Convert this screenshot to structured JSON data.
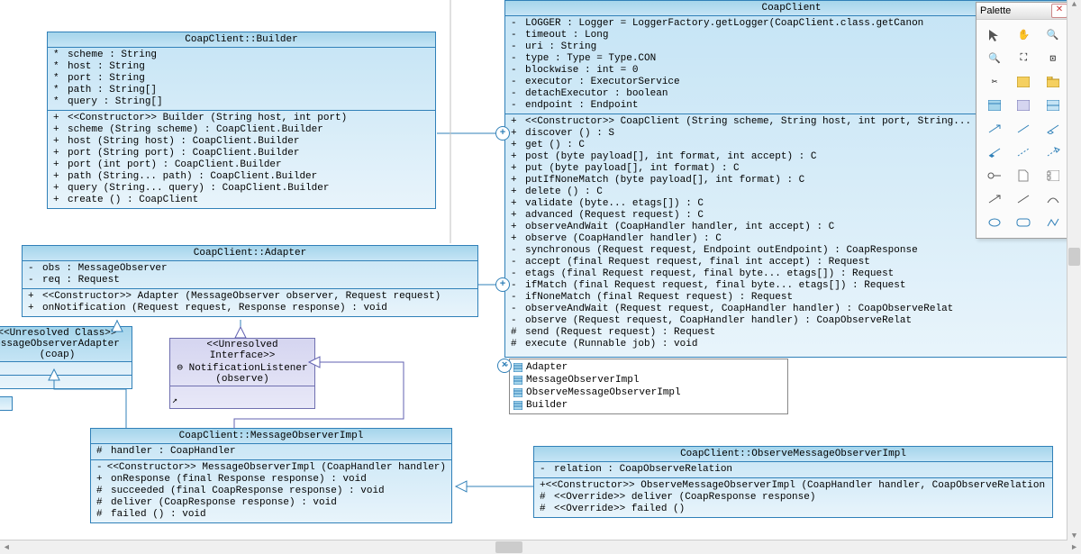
{
  "palette_title": "Palette",
  "builder": {
    "title": "CoapClient::Builder",
    "attrs": [
      {
        "v": "*",
        "t": "scheme  : String"
      },
      {
        "v": "*",
        "t": "host    : String"
      },
      {
        "v": "*",
        "t": "port    : String"
      },
      {
        "v": "*",
        "t": "path    : String[]"
      },
      {
        "v": "*",
        "t": "query   : String[]"
      }
    ],
    "ops": [
      {
        "v": "+",
        "t": "<<Constructor>>  Builder (String host, int port)"
      },
      {
        "v": "+",
        "t": "                 scheme (String scheme)          : CoapClient.Builder"
      },
      {
        "v": "+",
        "t": "                 host (String host)              : CoapClient.Builder"
      },
      {
        "v": "+",
        "t": "                 port (String port)              : CoapClient.Builder"
      },
      {
        "v": "+",
        "t": "                 port (int port)                 : CoapClient.Builder"
      },
      {
        "v": "+",
        "t": "                 path (String... path)           : CoapClient.Builder"
      },
      {
        "v": "+",
        "t": "                 query (String... query)         : CoapClient.Builder"
      },
      {
        "v": "+",
        "t": "                 create ()                       : CoapClient"
      }
    ]
  },
  "adapter": {
    "title": "CoapClient::Adapter",
    "attrs": [
      {
        "v": "-",
        "t": "obs  : MessageObserver"
      },
      {
        "v": "-",
        "t": "req  : Request"
      }
    ],
    "ops": [
      {
        "v": "+",
        "t": "<<Constructor>>  Adapter (MessageObserver observer, Request request)"
      },
      {
        "v": "+",
        "t": "                 onNotification (Request request, Response response)  : void"
      }
    ]
  },
  "unresolved_class": {
    "stereo": "<<Unresolved Class>>",
    "name": "essageObserverAdapter",
    "pkg": "(coap)"
  },
  "unresolved_iface": {
    "stereo": "<<Unresolved Interface>>",
    "name": "NotificationListener",
    "pkg": "(observe)"
  },
  "msgobs": {
    "title": "CoapClient::MessageObserverImpl",
    "attrs": [
      {
        "v": "#",
        "t": "handler  : CoapHandler"
      }
    ],
    "ops": [
      {
        "v": "-",
        "t": "<<Constructor>>  MessageObserverImpl (CoapHandler handler)"
      },
      {
        "v": "+",
        "t": "                 onResponse (final Response response)        : void"
      },
      {
        "v": "#",
        "t": "                 succeeded (final CoapResponse response)     : void"
      },
      {
        "v": "#",
        "t": "                 deliver (CoapResponse response)             : void"
      },
      {
        "v": "#",
        "t": "                 failed ()                                   : void"
      }
    ]
  },
  "obsmsg": {
    "title": "CoapClient::ObserveMessageObserverImpl",
    "attrs": [
      {
        "v": "-",
        "t": "relation  : CoapObserveRelation"
      }
    ],
    "ops": [
      {
        "v": "+",
        "t": "<<Constructor>>  ObserveMessageObserverImpl (CoapHandler handler, CoapObserveRelation relation)"
      },
      {
        "v": "#",
        "t": "<<Override>>     deliver (CoapResponse response)"
      },
      {
        "v": "#",
        "t": "<<Override>>     failed ()"
      }
    ]
  },
  "coapclient": {
    "title": "CoapClient",
    "attrs": [
      {
        "v": "-",
        "t": "LOGGER          : Logger           = LoggerFactory.getLogger(CoapClient.class.getCanon"
      },
      {
        "v": "-",
        "t": "timeout         : Long"
      },
      {
        "v": "-",
        "t": "uri             : String"
      },
      {
        "v": "-",
        "t": "type            : Type             = Type.CON"
      },
      {
        "v": "-",
        "t": "blockwise       : int              = 0"
      },
      {
        "v": "-",
        "t": "executor        : ExecutorService"
      },
      {
        "v": "-",
        "t": "detachExecutor  : boolean"
      },
      {
        "v": "-",
        "t": "endpoint        : Endpoint"
      }
    ],
    "ops": [
      {
        "v": "+",
        "t": "<<Constructor>>  CoapClient (String scheme, String host, int port, String... path)"
      },
      {
        "v": "+",
        "t": "                 discover ()                                                          : S"
      },
      {
        "v": "+",
        "t": "                 get ()                                                               : C"
      },
      {
        "v": "+",
        "t": "                 post (byte payload[], int format, int accept)                        : C"
      },
      {
        "v": "+",
        "t": "                 put (byte payload[], int format)                                     : C"
      },
      {
        "v": "+",
        "t": "                 putIfNoneMatch (byte payload[], int format)                          : C"
      },
      {
        "v": "+",
        "t": "                 delete ()                                                            : C"
      },
      {
        "v": "+",
        "t": "                 validate (byte... etags[])                                           : C"
      },
      {
        "v": "+",
        "t": "                 advanced (Request request)                                           : C"
      },
      {
        "v": "+",
        "t": "                 observeAndWait (CoapHandler handler, int accept)                     : C"
      },
      {
        "v": "+",
        "t": "                 observe (CoapHandler handler)                                        : C"
      },
      {
        "v": "-",
        "t": "                 synchronous (Request request, Endpoint outEndpoint)                  : CoapResponse"
      },
      {
        "v": "-",
        "t": "                 accept (final Request request, final int accept)                     : Request"
      },
      {
        "v": "-",
        "t": "                 etags (final Request request, final byte... etags[])                 : Request"
      },
      {
        "v": "-",
        "t": "                 ifMatch (final Request request, final byte... etags[])               : Request"
      },
      {
        "v": "-",
        "t": "                 ifNoneMatch (final Request request)                                  : Request"
      },
      {
        "v": "-",
        "t": "                 observeAndWait (Request request, CoapHandler handler)                : CoapObserveRelat"
      },
      {
        "v": "-",
        "t": "                 observe (Request request, CoapHandler handler)                       : CoapObserveRelat"
      },
      {
        "v": "#",
        "t": "                 send (Request request)                                               : Request"
      },
      {
        "v": "#",
        "t": "                 execute (Runnable job)                                               : void"
      }
    ]
  },
  "nested": {
    "items": [
      "Adapter",
      "MessageObserverImpl",
      "ObserveMessageObserverImpl",
      "Builder"
    ]
  },
  "chart_data": {
    "type": "uml-class-diagram",
    "classes": [
      {
        "name": "CoapClient::Builder",
        "kind": "class",
        "attributes": [
          "* scheme:String",
          "* host:String",
          "* port:String",
          "* path:String[]",
          "* query:String[]"
        ],
        "operations": [
          "+ <<Constructor>> Builder(String host,int port)",
          "+ scheme(String scheme):CoapClient.Builder",
          "+ host(String host):CoapClient.Builder",
          "+ port(String port):CoapClient.Builder",
          "+ port(int port):CoapClient.Builder",
          "+ path(String... path):CoapClient.Builder",
          "+ query(String... query):CoapClient.Builder",
          "+ create():CoapClient"
        ]
      },
      {
        "name": "CoapClient::Adapter",
        "kind": "class",
        "attributes": [
          "- obs:MessageObserver",
          "- req:Request"
        ],
        "operations": [
          "+ <<Constructor>> Adapter(MessageObserver observer,Request request)",
          "+ onNotification(Request request,Response response):void"
        ]
      },
      {
        "name": "CoapClient::MessageObserverImpl",
        "kind": "class",
        "attributes": [
          "# handler:CoapHandler"
        ],
        "operations": [
          "- <<Constructor>> MessageObserverImpl(CoapHandler handler)",
          "+ onResponse(final Response response):void",
          "# succeeded(final CoapResponse response):void",
          "# deliver(CoapResponse response):void",
          "# failed():void"
        ]
      },
      {
        "name": "CoapClient::ObserveMessageObserverImpl",
        "kind": "class",
        "attributes": [
          "- relation:CoapObserveRelation"
        ],
        "operations": [
          "+ <<Constructor>> ObserveMessageObserverImpl(CoapHandler handler,CoapObserveRelation relation)",
          "# <<Override>> deliver(CoapResponse response)",
          "# <<Override>> failed()"
        ]
      },
      {
        "name": "CoapClient",
        "kind": "class",
        "attributes": [
          "- LOGGER:Logger = LoggerFactory.getLogger(CoapClient.class.getCanon",
          "- timeout:Long",
          "- uri:String",
          "- type:Type = Type.CON",
          "- blockwise:int = 0",
          "- executor:ExecutorService",
          "- detachExecutor:boolean",
          "- endpoint:Endpoint"
        ],
        "operations": [
          "+ <<Constructor>> CoapClient(String scheme,String host,int port,String... path)",
          "+ discover()",
          "+ get()",
          "+ post(byte payload[],int format,int accept)",
          "+ put(byte payload[],int format)",
          "+ putIfNoneMatch(byte payload[],int format)",
          "+ delete()",
          "+ validate(byte... etags[])",
          "+ advanced(Request request)",
          "+ observeAndWait(CoapHandler handler,int accept)",
          "+ observe(CoapHandler handler)",
          "- synchronous(Request request,Endpoint outEndpoint):CoapResponse",
          "- accept(final Request request,final int accept):Request",
          "- etags(final Request request,final byte... etags[]):Request",
          "- ifMatch(final Request request,final byte... etags[]):Request",
          "- ifNoneMatch(final Request request):Request",
          "- observeAndWait(Request request,CoapHandler handler):CoapObserveRelat",
          "- observe(Request request,CoapHandler handler):CoapObserveRelat",
          "# send(Request request):Request",
          "# execute(Runnable job):void"
        ],
        "nested": [
          "Adapter",
          "MessageObserverImpl",
          "ObserveMessageObserverImpl",
          "Builder"
        ]
      },
      {
        "name": "essageObserverAdapter",
        "kind": "unresolved-class",
        "package": "coap"
      },
      {
        "name": "NotificationListener",
        "kind": "unresolved-interface",
        "package": "observe"
      }
    ],
    "relations": [
      {
        "from": "CoapClient::Builder",
        "to": "CoapClient",
        "type": "nested"
      },
      {
        "from": "CoapClient::Adapter",
        "to": "CoapClient",
        "type": "nested"
      },
      {
        "from": "CoapClient::Adapter",
        "to": "essageObserverAdapter",
        "type": "generalization"
      },
      {
        "from": "CoapClient::Adapter",
        "to": "NotificationListener",
        "type": "realization"
      },
      {
        "from": "CoapClient::MessageObserverImpl",
        "to": "essageObserverAdapter",
        "type": "generalization"
      },
      {
        "from": "CoapClient::ObserveMessageObserverImpl",
        "to": "CoapClient::MessageObserverImpl",
        "type": "generalization"
      }
    ]
  }
}
